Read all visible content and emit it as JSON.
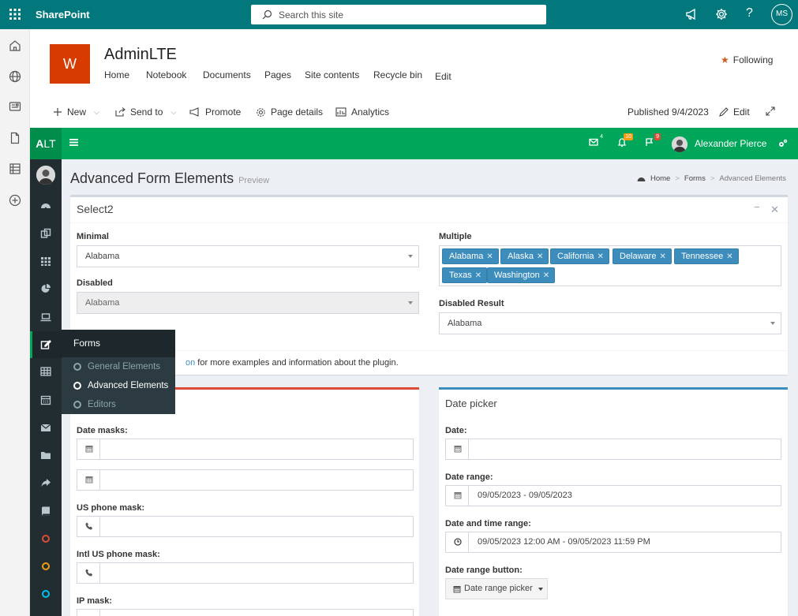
{
  "sharepoint": {
    "brand": "SharePoint",
    "search_placeholder": "Search this site",
    "help": "?",
    "user_initials": "MS"
  },
  "site": {
    "logo_letter": "W",
    "title": "AdminLTE",
    "nav": [
      "Home",
      "Notebook",
      "Documents",
      "Pages",
      "Site contents",
      "Recycle bin",
      "Edit"
    ],
    "following": "Following"
  },
  "command_bar": {
    "new": "New",
    "send_to": "Send to",
    "promote": "Promote",
    "page_details": "Page details",
    "analytics": "Analytics",
    "published": "Published 9/4/2023",
    "edit": "Edit"
  },
  "adminlte": {
    "logo_a": "A",
    "logo_lt": "LT",
    "badges": {
      "messages": "4",
      "notifications": "10",
      "tasks": "9"
    },
    "badge_colors": {
      "messages": "#00a65a",
      "notifications": "#f39c12",
      "tasks": "#dd4b39"
    },
    "user_name": "Alexander Pierce",
    "accent": "#00a65a"
  },
  "sidebar": {
    "flyout_title": "Forms",
    "flyout_items": [
      "General Elements",
      "Advanced Elements",
      "Editors"
    ],
    "active_item": "Advanced Elements",
    "circle_colors": [
      "#dd4b39",
      "#f39c12",
      "#00c0ef"
    ]
  },
  "page": {
    "title": "Advanced Form Elements",
    "subtitle": "Preview",
    "breadcrumb": [
      "Home",
      "Forms",
      "Advanced Elements"
    ]
  },
  "select2_box": {
    "title": "Select2",
    "minimal_label": "Minimal",
    "minimal_value": "Alabama",
    "disabled_label": "Disabled",
    "disabled_value": "Alabama",
    "multiple_label": "Multiple",
    "multiple_tags": [
      "Alabama",
      "Alaska",
      "California",
      "Delaware",
      "Tennessee",
      "Texas",
      "Washington"
    ],
    "disabled_result_label": "Disabled Result",
    "disabled_result_value": "Alabama",
    "footer_link": "on",
    "footer_text": " for more examples and information about the plugin."
  },
  "inputmask_box": {
    "date_masks_label": "Date masks:",
    "us_phone_label": "US phone mask:",
    "intl_phone_label": "Intl US phone mask:",
    "ip_label": "IP mask:"
  },
  "date_box": {
    "title": "Date picker",
    "date_label": "Date:",
    "date_range_label": "Date range:",
    "date_range_value": "09/05/2023 - 09/05/2023",
    "datetime_range_label": "Date and time range:",
    "datetime_range_value": "09/05/2023 12:00 AM - 09/05/2023 11:59 PM",
    "range_button_label": "Date range button:",
    "range_button_text": "Date range picker"
  }
}
